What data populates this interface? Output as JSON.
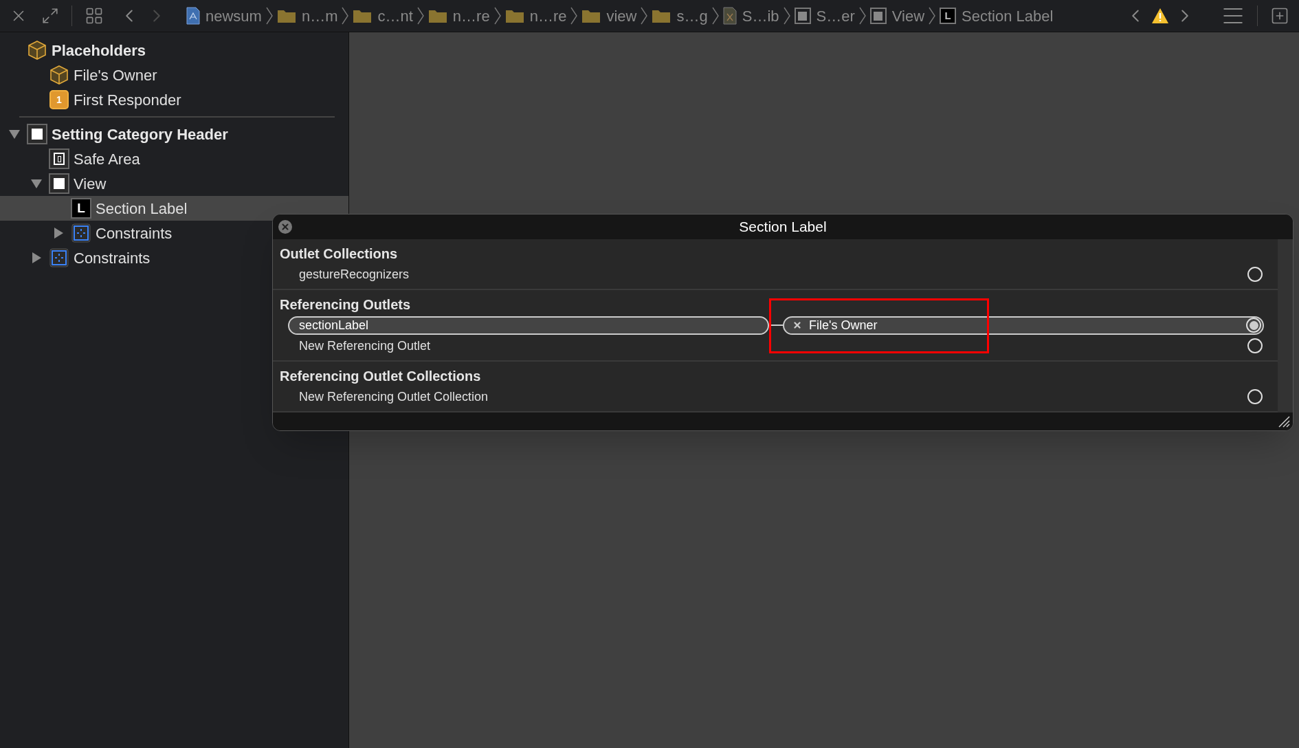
{
  "toolbar": {
    "forward_disabled": true,
    "breadcrumbs": [
      {
        "label": "newsum",
        "kind": "project"
      },
      {
        "label": "n…m",
        "kind": "folder"
      },
      {
        "label": "c…nt",
        "kind": "folder"
      },
      {
        "label": "n…re",
        "kind": "folder"
      },
      {
        "label": "n…re",
        "kind": "folder"
      },
      {
        "label": "view",
        "kind": "folder"
      },
      {
        "label": "s…g",
        "kind": "folder"
      },
      {
        "label": "S…ib",
        "kind": "xib"
      },
      {
        "label": "S…er",
        "kind": "view"
      },
      {
        "label": "View",
        "kind": "view"
      },
      {
        "label": "Section Label",
        "kind": "label",
        "icon_text": "L"
      }
    ]
  },
  "sidebar": {
    "items": [
      {
        "label": "Placeholders",
        "kind": "cube",
        "bold": true,
        "selected": false,
        "children": [
          {
            "label": "File's Owner",
            "kind": "cube",
            "selected": false
          },
          {
            "label": "First Responder",
            "kind": "responder",
            "icon_text": "1",
            "selected": false
          }
        ]
      },
      {
        "label": "Setting Category Header",
        "kind": "view",
        "bold": true,
        "expanded": true,
        "selected": false,
        "children": [
          {
            "label": "Safe Area",
            "kind": "safearea",
            "selected": false
          },
          {
            "label": "View",
            "kind": "view",
            "expanded": true,
            "selected": false,
            "children": [
              {
                "label": "Section Label",
                "kind": "label",
                "icon_text": "L",
                "selected": true
              },
              {
                "label": "Constraints",
                "kind": "constraints",
                "expanded": false,
                "selected": false
              }
            ]
          },
          {
            "label": "Constraints",
            "kind": "constraints",
            "expanded": false,
            "selected": false
          }
        ]
      }
    ]
  },
  "popup": {
    "title": "Section Label",
    "sections": [
      {
        "title": "Outlet Collections",
        "rows": [
          {
            "label": "gestureRecognizers",
            "connected": false
          }
        ]
      },
      {
        "title": "Referencing Outlets",
        "rows": [
          {
            "label": "sectionLabel",
            "connected": true,
            "target": "File's Owner"
          },
          {
            "label": "New Referencing Outlet",
            "connected": false
          }
        ]
      },
      {
        "title": "Referencing Outlet Collections",
        "rows": [
          {
            "label": "New Referencing Outlet Collection",
            "connected": false
          }
        ]
      }
    ]
  }
}
